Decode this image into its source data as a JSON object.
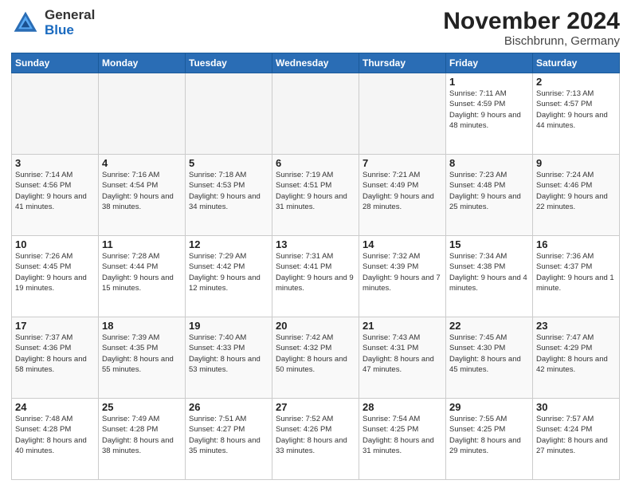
{
  "header": {
    "logo_general": "General",
    "logo_blue": "Blue",
    "title": "November 2024",
    "subtitle": "Bischbrunn, Germany"
  },
  "days_of_week": [
    "Sunday",
    "Monday",
    "Tuesday",
    "Wednesday",
    "Thursday",
    "Friday",
    "Saturday"
  ],
  "weeks": [
    [
      {
        "day": "",
        "info": ""
      },
      {
        "day": "",
        "info": ""
      },
      {
        "day": "",
        "info": ""
      },
      {
        "day": "",
        "info": ""
      },
      {
        "day": "",
        "info": ""
      },
      {
        "day": "1",
        "info": "Sunrise: 7:11 AM\nSunset: 4:59 PM\nDaylight: 9 hours and 48 minutes."
      },
      {
        "day": "2",
        "info": "Sunrise: 7:13 AM\nSunset: 4:57 PM\nDaylight: 9 hours and 44 minutes."
      }
    ],
    [
      {
        "day": "3",
        "info": "Sunrise: 7:14 AM\nSunset: 4:56 PM\nDaylight: 9 hours and 41 minutes."
      },
      {
        "day": "4",
        "info": "Sunrise: 7:16 AM\nSunset: 4:54 PM\nDaylight: 9 hours and 38 minutes."
      },
      {
        "day": "5",
        "info": "Sunrise: 7:18 AM\nSunset: 4:53 PM\nDaylight: 9 hours and 34 minutes."
      },
      {
        "day": "6",
        "info": "Sunrise: 7:19 AM\nSunset: 4:51 PM\nDaylight: 9 hours and 31 minutes."
      },
      {
        "day": "7",
        "info": "Sunrise: 7:21 AM\nSunset: 4:49 PM\nDaylight: 9 hours and 28 minutes."
      },
      {
        "day": "8",
        "info": "Sunrise: 7:23 AM\nSunset: 4:48 PM\nDaylight: 9 hours and 25 minutes."
      },
      {
        "day": "9",
        "info": "Sunrise: 7:24 AM\nSunset: 4:46 PM\nDaylight: 9 hours and 22 minutes."
      }
    ],
    [
      {
        "day": "10",
        "info": "Sunrise: 7:26 AM\nSunset: 4:45 PM\nDaylight: 9 hours and 19 minutes."
      },
      {
        "day": "11",
        "info": "Sunrise: 7:28 AM\nSunset: 4:44 PM\nDaylight: 9 hours and 15 minutes."
      },
      {
        "day": "12",
        "info": "Sunrise: 7:29 AM\nSunset: 4:42 PM\nDaylight: 9 hours and 12 minutes."
      },
      {
        "day": "13",
        "info": "Sunrise: 7:31 AM\nSunset: 4:41 PM\nDaylight: 9 hours and 9 minutes."
      },
      {
        "day": "14",
        "info": "Sunrise: 7:32 AM\nSunset: 4:39 PM\nDaylight: 9 hours and 7 minutes."
      },
      {
        "day": "15",
        "info": "Sunrise: 7:34 AM\nSunset: 4:38 PM\nDaylight: 9 hours and 4 minutes."
      },
      {
        "day": "16",
        "info": "Sunrise: 7:36 AM\nSunset: 4:37 PM\nDaylight: 9 hours and 1 minute."
      }
    ],
    [
      {
        "day": "17",
        "info": "Sunrise: 7:37 AM\nSunset: 4:36 PM\nDaylight: 8 hours and 58 minutes."
      },
      {
        "day": "18",
        "info": "Sunrise: 7:39 AM\nSunset: 4:35 PM\nDaylight: 8 hours and 55 minutes."
      },
      {
        "day": "19",
        "info": "Sunrise: 7:40 AM\nSunset: 4:33 PM\nDaylight: 8 hours and 53 minutes."
      },
      {
        "day": "20",
        "info": "Sunrise: 7:42 AM\nSunset: 4:32 PM\nDaylight: 8 hours and 50 minutes."
      },
      {
        "day": "21",
        "info": "Sunrise: 7:43 AM\nSunset: 4:31 PM\nDaylight: 8 hours and 47 minutes."
      },
      {
        "day": "22",
        "info": "Sunrise: 7:45 AM\nSunset: 4:30 PM\nDaylight: 8 hours and 45 minutes."
      },
      {
        "day": "23",
        "info": "Sunrise: 7:47 AM\nSunset: 4:29 PM\nDaylight: 8 hours and 42 minutes."
      }
    ],
    [
      {
        "day": "24",
        "info": "Sunrise: 7:48 AM\nSunset: 4:28 PM\nDaylight: 8 hours and 40 minutes."
      },
      {
        "day": "25",
        "info": "Sunrise: 7:49 AM\nSunset: 4:28 PM\nDaylight: 8 hours and 38 minutes."
      },
      {
        "day": "26",
        "info": "Sunrise: 7:51 AM\nSunset: 4:27 PM\nDaylight: 8 hours and 35 minutes."
      },
      {
        "day": "27",
        "info": "Sunrise: 7:52 AM\nSunset: 4:26 PM\nDaylight: 8 hours and 33 minutes."
      },
      {
        "day": "28",
        "info": "Sunrise: 7:54 AM\nSunset: 4:25 PM\nDaylight: 8 hours and 31 minutes."
      },
      {
        "day": "29",
        "info": "Sunrise: 7:55 AM\nSunset: 4:25 PM\nDaylight: 8 hours and 29 minutes."
      },
      {
        "day": "30",
        "info": "Sunrise: 7:57 AM\nSunset: 4:24 PM\nDaylight: 8 hours and 27 minutes."
      }
    ]
  ]
}
